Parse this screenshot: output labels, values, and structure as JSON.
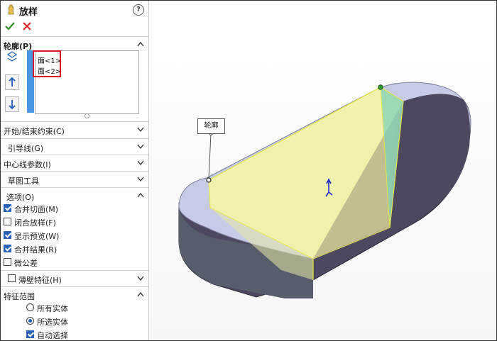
{
  "feature": {
    "title": "放样",
    "icon": "loft-feature-icon",
    "help_icon": "help-icon",
    "ok_icon": "check-icon",
    "cancel_icon": "close-icon"
  },
  "profiles": {
    "header": "轮廓(P)",
    "items": [
      "面<1>",
      "面<2>"
    ],
    "icons": [
      "profile-icon",
      "move-up-icon",
      "move-down-icon"
    ]
  },
  "collapsed_sections": [
    {
      "label": "开始/结束约束(C)"
    },
    {
      "label": "引导线(G)"
    },
    {
      "label": "中心线参数(I)"
    },
    {
      "label": "草图工具"
    }
  ],
  "options": {
    "header": "选项(O)",
    "items": [
      {
        "label": "合并切面(M)",
        "checked": true
      },
      {
        "label": "闭合放样(F)",
        "checked": false
      },
      {
        "label": "显示预览(W)",
        "checked": true
      },
      {
        "label": "合并结果(R)",
        "checked": true
      },
      {
        "label": "微公差",
        "checked": false
      }
    ]
  },
  "thin_feature": {
    "label": "薄壁特征(H)",
    "checked": false
  },
  "feature_scope": {
    "header": "特征范围",
    "radios": [
      {
        "label": "所有实体",
        "selected": false
      },
      {
        "label": "所选实体",
        "selected": true
      }
    ],
    "auto_select": {
      "label": "自动选择",
      "checked": true
    }
  },
  "viewport": {
    "callout_label": "轮廓",
    "colors": {
      "face_top": "#c7cbe6",
      "face_side": "#4e4760",
      "loft_preview": "#ffff99",
      "edge_highlight": "#e7e74a",
      "point_green": "#2ea02e"
    }
  }
}
